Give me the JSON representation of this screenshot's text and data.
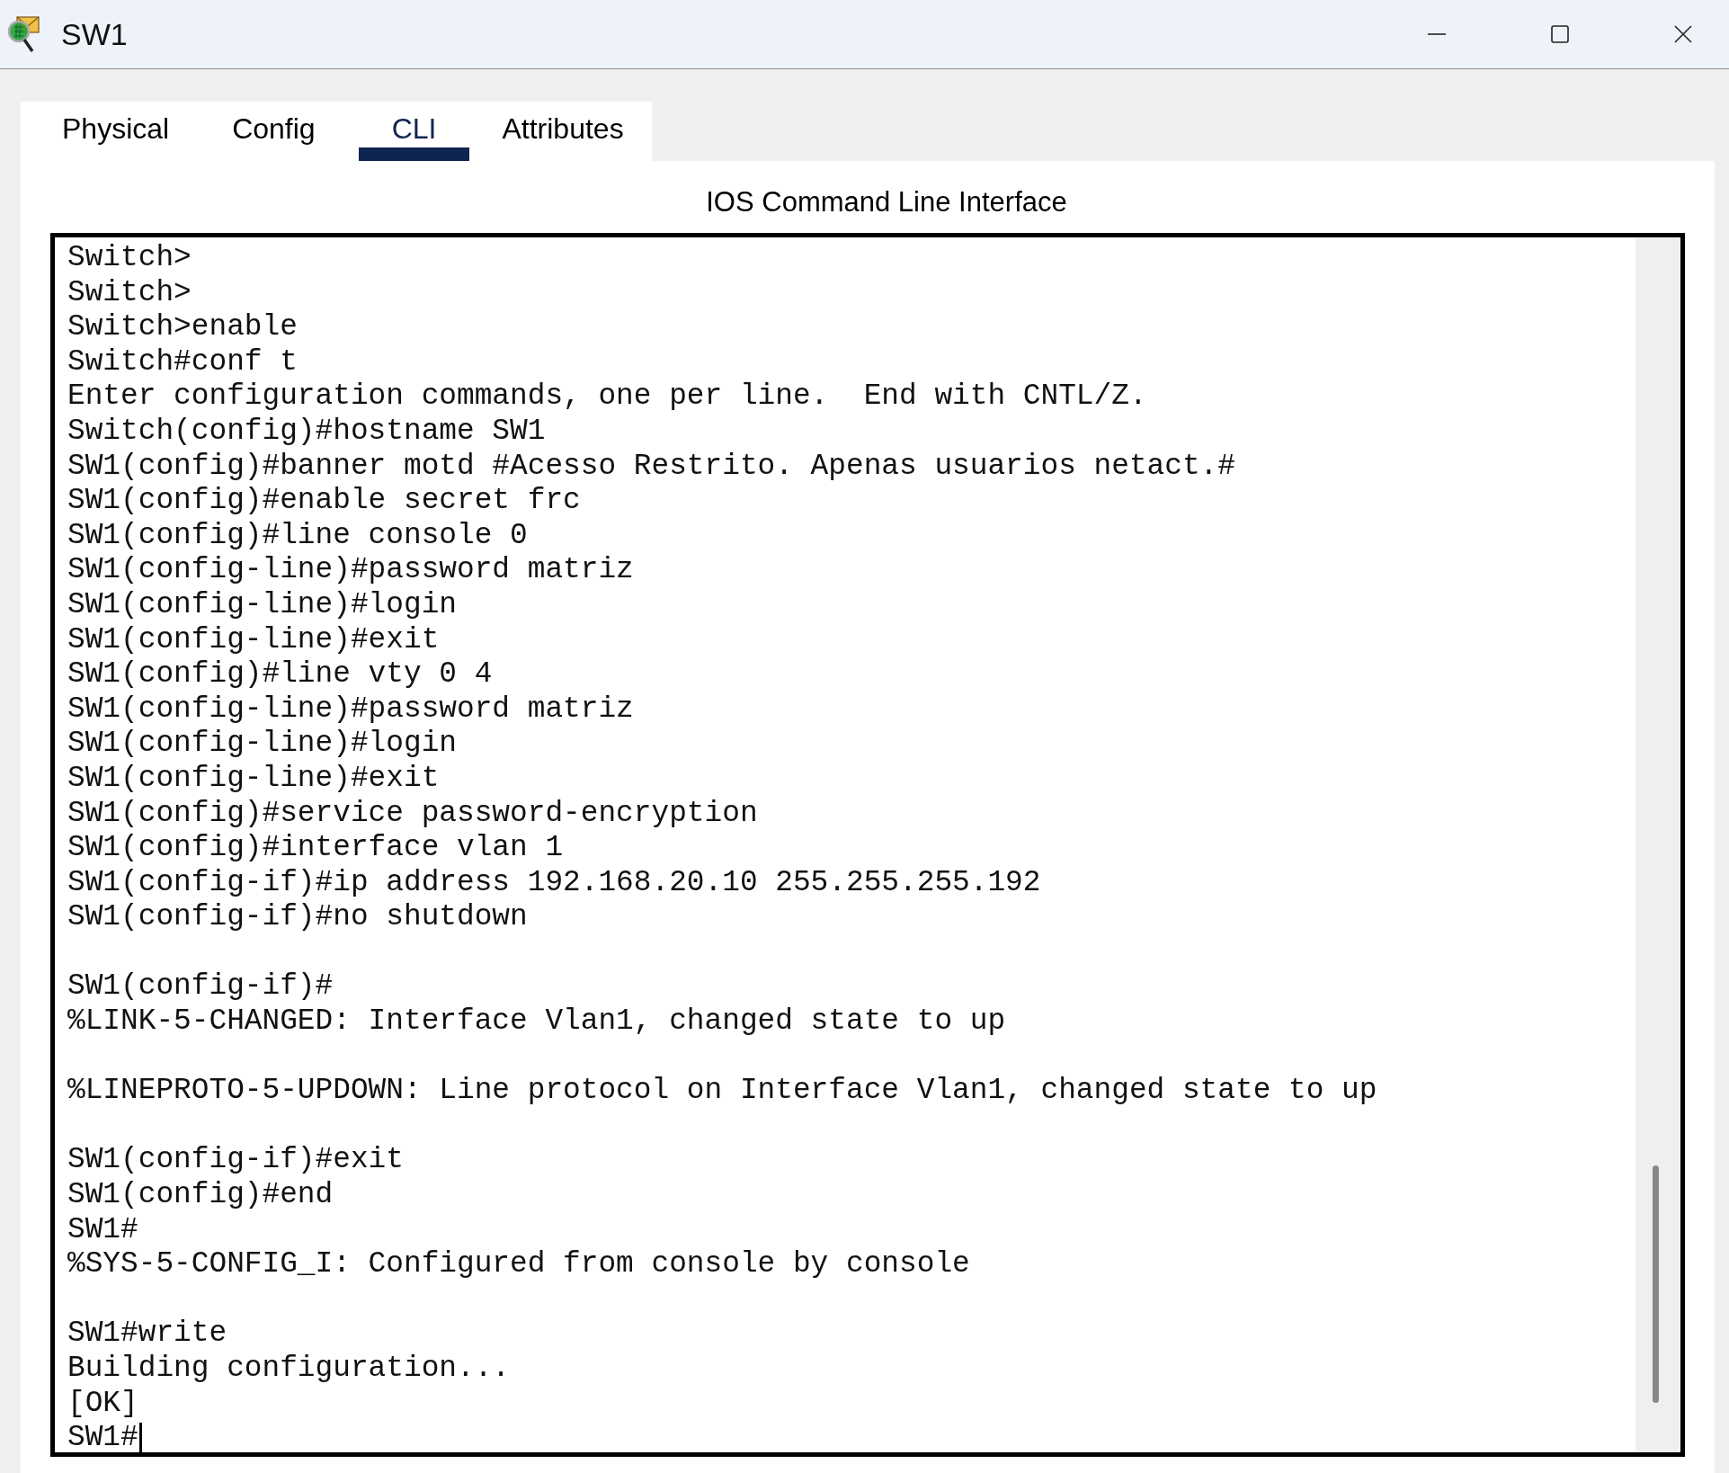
{
  "window": {
    "title": "SW1"
  },
  "tabs": [
    {
      "label": "Physical",
      "selected": false
    },
    {
      "label": "Config",
      "selected": false
    },
    {
      "label": "CLI",
      "selected": true
    },
    {
      "label": "Attributes",
      "selected": false
    }
  ],
  "panel": {
    "title": "IOS Command Line Interface"
  },
  "terminal": {
    "cursor_visible": true,
    "lines": [
      {
        "kind": "text",
        "text": "Switch>"
      },
      {
        "kind": "text",
        "text": "Switch>"
      },
      {
        "kind": "text",
        "text": "Switch>enable"
      },
      {
        "kind": "text",
        "text": "Switch#conf t"
      },
      {
        "kind": "text",
        "text": "Enter configuration commands, one per line.  End with CNTL/Z."
      },
      {
        "kind": "text",
        "text": "Switch(config)#hostname SW1"
      },
      {
        "kind": "text",
        "text": "SW1(config)#banner motd #Acesso Restrito. Apenas usuarios netact.#"
      },
      {
        "kind": "text",
        "text": "SW1(config)#enable secret frc"
      },
      {
        "kind": "text",
        "text": "SW1(config)#line console 0"
      },
      {
        "kind": "text",
        "text": "SW1(config-line)#password matriz"
      },
      {
        "kind": "text",
        "text": "SW1(config-line)#login"
      },
      {
        "kind": "text",
        "text": "SW1(config-line)#exit"
      },
      {
        "kind": "text",
        "text": "SW1(config)#line vty 0 4"
      },
      {
        "kind": "text",
        "text": "SW1(config-line)#password matriz"
      },
      {
        "kind": "text",
        "text": "SW1(config-line)#login"
      },
      {
        "kind": "text",
        "text": "SW1(config-line)#exit"
      },
      {
        "kind": "text",
        "text": "SW1(config)#service password-encryption"
      },
      {
        "kind": "text",
        "text": "SW1(config)#interface vlan 1"
      },
      {
        "kind": "text",
        "text": "SW1(config-if)#ip address 192.168.20.10 255.255.255.192"
      },
      {
        "kind": "text",
        "text": "SW1(config-if)#no shutdown"
      },
      {
        "kind": "blank"
      },
      {
        "kind": "text",
        "text": "SW1(config-if)#"
      },
      {
        "kind": "text",
        "text": "%LINK-5-CHANGED: Interface Vlan1, changed state to up"
      },
      {
        "kind": "blank"
      },
      {
        "kind": "text",
        "text": "%LINEPROTO-5-UPDOWN: Line protocol on Interface Vlan1, changed state to up"
      },
      {
        "kind": "blank"
      },
      {
        "kind": "text",
        "text": "SW1(config-if)#exit"
      },
      {
        "kind": "text",
        "text": "SW1(config)#end"
      },
      {
        "kind": "text",
        "text": "SW1#"
      },
      {
        "kind": "text",
        "text": "%SYS-5-CONFIG_I: Configured from console by console"
      },
      {
        "kind": "blank"
      },
      {
        "kind": "text",
        "text": "SW1#write"
      },
      {
        "kind": "text",
        "text": "Building configuration..."
      },
      {
        "kind": "text",
        "text": "[OK]"
      },
      {
        "kind": "text",
        "text": "SW1#"
      }
    ]
  }
}
